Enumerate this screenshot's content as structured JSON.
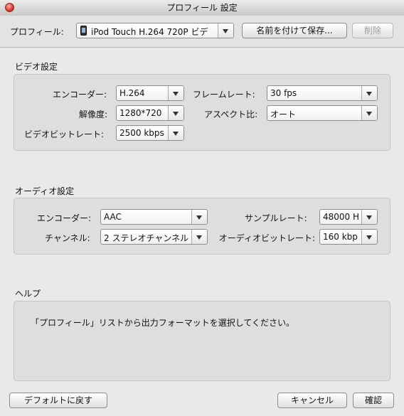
{
  "window": {
    "title": "プロフィール 設定"
  },
  "profile": {
    "label": "プロフィール:",
    "value": "iPod Touch H.264 720P ビデ",
    "save_as_label": "名前を付けて保存...",
    "delete_label": "削除"
  },
  "video": {
    "section_title": "ビデオ設定",
    "encoder_label": "エンコーダー:",
    "encoder_value": "H.264",
    "framerate_label": "フレームレート:",
    "framerate_value": "30 fps",
    "resolution_label": "解像度:",
    "resolution_value": "1280*720",
    "aspect_label": "アスペクト比:",
    "aspect_value": "オート",
    "bitrate_label": "ビデオビットレート:",
    "bitrate_value": "2500 kbps"
  },
  "audio": {
    "section_title": "オーディオ設定",
    "encoder_label": "エンコーダー:",
    "encoder_value": "AAC",
    "samplerate_label": "サンプルレート:",
    "samplerate_value": "48000 H",
    "channel_label": "チャンネル:",
    "channel_value": "2 ステレオチャンネル",
    "bitrate_label": "オーディオビットレート:",
    "bitrate_value": "160 kbp"
  },
  "help": {
    "section_title": "ヘルプ",
    "text": "「プロフィール」リストから出力フォーマットを選択してください。"
  },
  "footer": {
    "default_label": "デフォルトに戻す",
    "cancel_label": "キャンセル",
    "ok_label": "確認"
  }
}
